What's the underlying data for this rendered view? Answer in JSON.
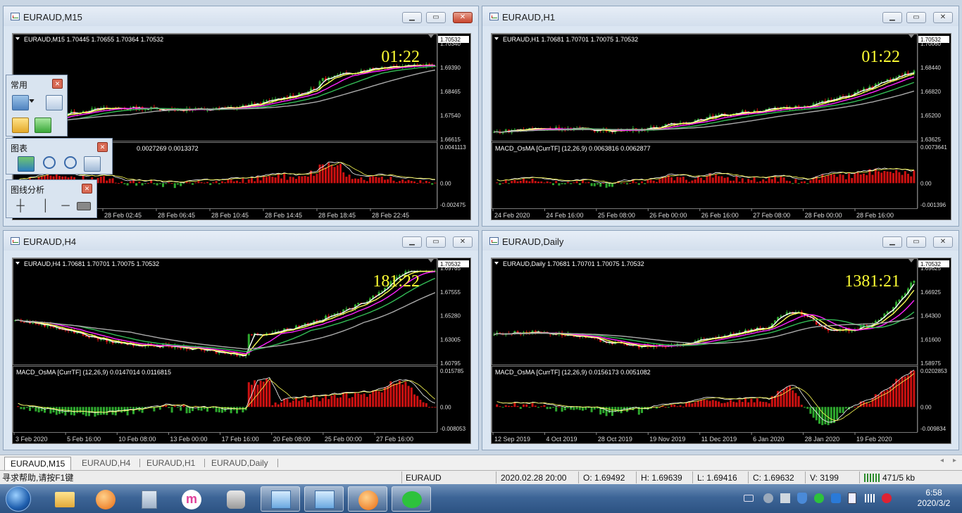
{
  "colors": {
    "chart_bg": "#000000",
    "bull": "#2ea82e",
    "bear": "#cc1111",
    "ma_white": "#ffffff",
    "ma_yellow": "#ffff55",
    "ma_magenta": "#ff22ff",
    "ma_green": "#33bb55",
    "ma_gray": "#aaaaaa",
    "timer": "#ffff33"
  },
  "windows": [
    {
      "id": "m15",
      "title": "EURAUD,M15",
      "info": "EURAUD,M15  1.70445 1.70655 1.70364 1.70532",
      "timer": "01:22",
      "price_badge": "1.70532",
      "price_labels": [
        "1.70340",
        "1.69390",
        "1.68465",
        "1.67540",
        "1.66615"
      ],
      "macd_label": "MACD_OsMA [CurrTF] (12,26,9) 0.0027269 0.0013372",
      "macd_visible_label": "0.0027269 0.0013372",
      "macd_levels": [
        "0.0041113",
        "0.00",
        "-0.002475"
      ],
      "time_labels": [
        "28 Feb 02:45",
        "28 Feb 06:45",
        "28 Feb 10:45",
        "28 Feb 14:45",
        "28 Feb 18:45",
        "28 Feb 22:45"
      ],
      "close_active": true,
      "trend": "m15"
    },
    {
      "id": "h1",
      "title": "EURAUD,H1",
      "info": "EURAUD,H1  1.70681 1.70701 1.70075 1.70532",
      "timer": "01:22",
      "price_badge": "1.70532",
      "price_labels": [
        "1.70060",
        "1.68440",
        "1.66820",
        "1.65200",
        "1.63625"
      ],
      "macd_label": "MACD_OsMA [CurrTF] (12,26,9) 0.0063816 0.0062877",
      "macd_levels": [
        "0.0073641",
        "0.00",
        "-0.001396"
      ],
      "time_labels": [
        "24 Feb 2020",
        "24 Feb 16:00",
        "25 Feb 08:00",
        "26 Feb 00:00",
        "26 Feb 16:00",
        "27 Feb 08:00",
        "28 Feb 00:00",
        "28 Feb 16:00"
      ],
      "close_active": false,
      "trend": "h1"
    },
    {
      "id": "h4",
      "title": "EURAUD,H4",
      "info": "EURAUD,H4  1.70681 1.70701 1.70075 1.70532",
      "timer": "181:22",
      "price_badge": "1.70532",
      "price_labels": [
        "1.69765",
        "1.67555",
        "1.65280",
        "1.63005",
        "1.60795"
      ],
      "macd_label": "MACD_OsMA [CurrTF] (12,26,9) 0.0147014 0.0116815",
      "macd_levels": [
        "0.015785",
        "0.00",
        "-0.008053"
      ],
      "time_labels": [
        "3 Feb 2020",
        "5 Feb 16:00",
        "10 Feb 08:00",
        "13 Feb 00:00",
        "17 Feb 16:00",
        "20 Feb 08:00",
        "25 Feb 00:00",
        "27 Feb 16:00"
      ],
      "close_active": false,
      "trend": "h4"
    },
    {
      "id": "d1",
      "title": "EURAUD,Daily",
      "info": "EURAUD,Daily  1.70681 1.70701 1.70075 1.70532",
      "timer": "1381:21",
      "price_badge": "1.70532",
      "price_labels": [
        "1.69625",
        "1.66925",
        "1.64300",
        "1.61600",
        "1.58975"
      ],
      "macd_label": "MACD_OsMA [CurrTF] (12,26,9) 0.0156173 0.0051082",
      "macd_levels": [
        "0.0202853",
        "0.00",
        "-0.009834"
      ],
      "time_labels": [
        "12 Sep 2019",
        "4 Oct 2019",
        "28 Oct 2019",
        "19 Nov 2019",
        "11 Dec 2019",
        "6 Jan 2020",
        "28 Jan 2020",
        "19 Feb 2020"
      ],
      "close_active": false,
      "trend": "d1"
    }
  ],
  "toolbars": {
    "common": {
      "title": "常用",
      "icons": [
        "new-chart-icon",
        "chart-dropdown-icon",
        "market-watch-icon",
        "open-folder-icon",
        "add-icon"
      ]
    },
    "charts": {
      "title": "图表",
      "icons": [
        "chart-grid-icon",
        "zoom-in-icon",
        "zoom-out-icon",
        "chart-template-icon"
      ]
    },
    "line_studies": {
      "title": "图线分析",
      "icons": [
        "crosshair-icon",
        "vertical-line-icon",
        "horizontal-line-icon",
        "rectangle-icon"
      ]
    }
  },
  "tabs": [
    {
      "label": "EURAUD,M15",
      "active": true
    },
    {
      "label": "EURAUD,H4",
      "active": false
    },
    {
      "label": "EURAUD,H1",
      "active": false
    },
    {
      "label": "EURAUD,Daily",
      "active": false
    }
  ],
  "status": {
    "help": "寻求帮助,请按F1键",
    "symbol": "EURAUD",
    "datetime": "2020.02.28 20:00",
    "open": "O: 1.69492",
    "high": "H: 1.69639",
    "low": "L: 1.69416",
    "close": "C: 1.69632",
    "volume": "V: 3199",
    "traffic": "471/5 kb"
  },
  "taskbar": {
    "time": "6:58",
    "date": "2020/3/2",
    "apps": [
      "start-button",
      "explorer-icon",
      "browser-icon",
      "calculator-icon",
      "m-app-icon",
      "qq-icon",
      "metatrader-icon",
      "metatrader-icon",
      "browser-icon",
      "wechat-icon"
    ]
  }
}
